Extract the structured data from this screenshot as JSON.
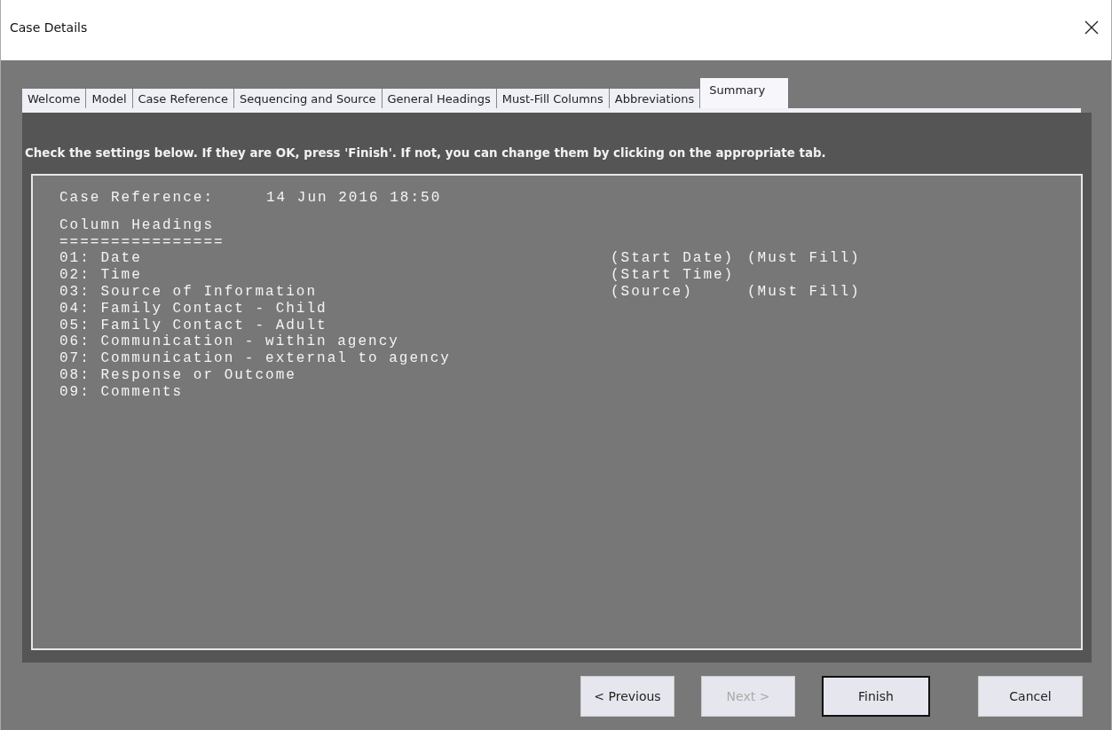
{
  "window": {
    "title": "Case Details"
  },
  "tabs": [
    {
      "label": "Welcome",
      "selected": false
    },
    {
      "label": "Model",
      "selected": false
    },
    {
      "label": "Case Reference",
      "selected": false
    },
    {
      "label": "Sequencing and Source",
      "selected": false
    },
    {
      "label": "General Headings",
      "selected": false
    },
    {
      "label": "Must-Fill Columns",
      "selected": false
    },
    {
      "label": "Abbreviations",
      "selected": false
    },
    {
      "label": "Summary",
      "selected": true
    }
  ],
  "instruction": "Check the settings below. If they are OK, press 'Finish'. If not, you can change them by clicking on the appropriate tab.",
  "summary": {
    "case_reference": {
      "label": "Case Reference:",
      "value": "14 Jun 2016 18:50"
    },
    "heading": "Column Headings",
    "underline": "================",
    "columns": [
      {
        "label": "01: Date",
        "field": "(Start Date)",
        "flag": "(Must Fill)"
      },
      {
        "label": "02: Time",
        "field": "(Start Time)"
      },
      {
        "label": "03: Source of Information",
        "field": "(Source)",
        "flag": "(Must Fill)"
      },
      {
        "label": "04: Family Contact - Child"
      },
      {
        "label": "05: Family Contact - Adult"
      },
      {
        "label": "06: Communication - within agency"
      },
      {
        "label": "07: Communication - external to agency"
      },
      {
        "label": "08: Response or Outcome"
      },
      {
        "label": "09: Comments"
      }
    ]
  },
  "buttons": [
    {
      "label": "< Previous",
      "disabled": false,
      "default": false
    },
    {
      "label": "Next >",
      "disabled": true,
      "default": false
    },
    {
      "label": "Finish",
      "disabled": false,
      "default": true
    },
    {
      "label": "Cancel",
      "disabled": false,
      "default": false
    }
  ]
}
